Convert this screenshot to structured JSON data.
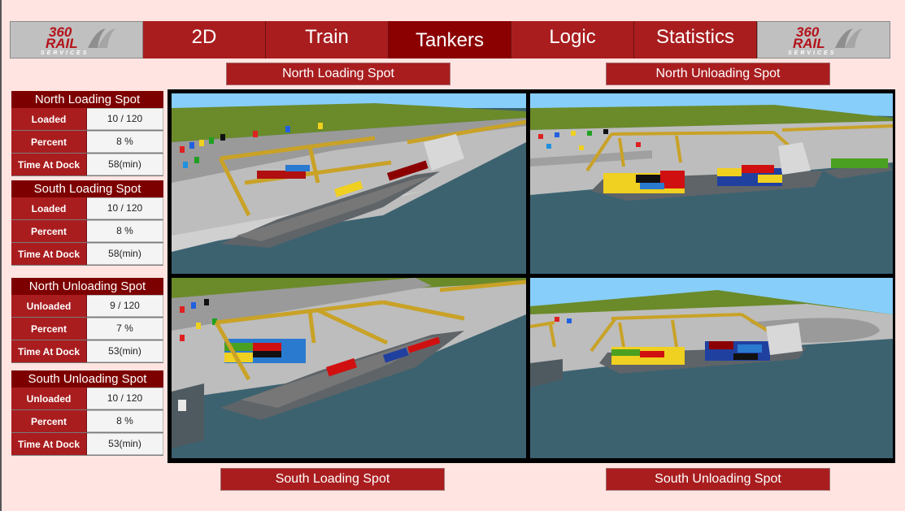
{
  "brand": {
    "logo_line1": "360",
    "logo_line2": "RAIL",
    "logo_line3": "SERVICES",
    "primary_color": "#a91d1f",
    "active_color": "#8b0000",
    "background": "#ffe4e1"
  },
  "nav": {
    "tabs": [
      {
        "label": "2D",
        "active": false
      },
      {
        "label": "Train",
        "active": false
      },
      {
        "label": "Tankers",
        "active": true
      },
      {
        "label": "Logic",
        "active": false
      },
      {
        "label": "Statistics",
        "active": false
      }
    ]
  },
  "view_labels": {
    "north_loading": "North Loading Spot",
    "north_unloading": "North Unloading Spot",
    "south_loading": "South Loading Spot",
    "south_unloading": "South Unloading Spot"
  },
  "panels": [
    {
      "title": "North Loading Spot",
      "rows": [
        {
          "label": "Loaded",
          "value": "10 / 120"
        },
        {
          "label": "Percent",
          "value": "8 %"
        },
        {
          "label": "Time At Dock",
          "value": "58(min)"
        }
      ]
    },
    {
      "title": "South Loading Spot",
      "rows": [
        {
          "label": "Loaded",
          "value": "10 / 120"
        },
        {
          "label": "Percent",
          "value": "8 %"
        },
        {
          "label": "Time At Dock",
          "value": "58(min)"
        }
      ]
    },
    {
      "title": "North Unloading Spot",
      "rows": [
        {
          "label": "Unloaded",
          "value": "9 / 120"
        },
        {
          "label": "Percent",
          "value": "7 %"
        },
        {
          "label": "Time At Dock",
          "value": "53(min)"
        }
      ]
    },
    {
      "title": "South Unloading Spot",
      "rows": [
        {
          "label": "Unloaded",
          "value": "10 / 120"
        },
        {
          "label": "Percent",
          "value": "8 %"
        },
        {
          "label": "Time At Dock",
          "value": "53(min)"
        }
      ]
    }
  ],
  "viewports": [
    {
      "name": "north-loading-view",
      "description": "3D port view with gantry cranes and container ship at north loading spot"
    },
    {
      "name": "north-unloading-view",
      "description": "3D port view with loaded container ship at north unloading spot"
    },
    {
      "name": "south-loading-view",
      "description": "3D port view with gantry cranes and container ship at south loading spot"
    },
    {
      "name": "south-unloading-view",
      "description": "3D port view with loaded container ship at south unloading spot"
    }
  ]
}
